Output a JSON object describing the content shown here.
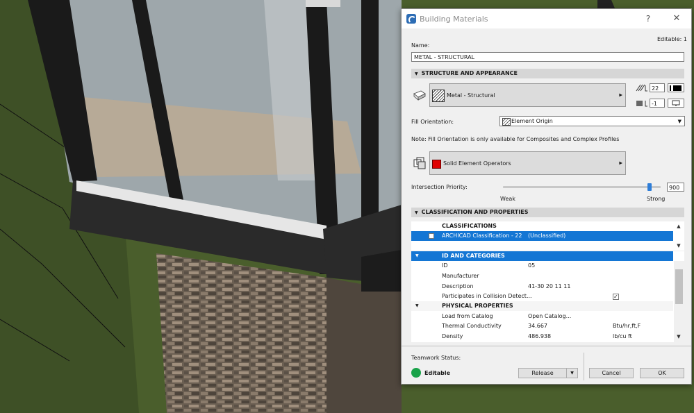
{
  "dialog": {
    "title": "Building Materials",
    "help": "?",
    "close": "✕",
    "editable": "Editable: 1",
    "name_label": "Name:",
    "name_value": "METAL - STRUCTURAL",
    "structure_section": "STRUCTURE AND APPEARANCE",
    "fill_name": "Metal - Structural",
    "pen_value": "22",
    "priority_field": "-1",
    "fill_orientation_label": "Fill Orientation:",
    "fill_orientation_value": "Element Origin",
    "note": "Note: Fill Orientation is only available for Composites and Complex Profiles",
    "solid_ops": "Solid Element Operators",
    "intersection_label": "Intersection Priority:",
    "intersection_value": "900",
    "intersection_fraction": 0.93,
    "weak": "Weak",
    "strong": "Strong",
    "classification_section": "CLASSIFICATION AND PROPERTIES",
    "classifications_header": "CLASSIFICATIONS",
    "classification_row": {
      "name": "ARCHICAD Classification - 22",
      "value": "(Unclassified)"
    },
    "id_categories": "ID AND CATEGORIES",
    "props": [
      {
        "name": "ID",
        "value": "05",
        "unit": ""
      },
      {
        "name": "Manufacturer",
        "value": "",
        "unit": ""
      },
      {
        "name": "Description",
        "value": "41-30 20 11 11",
        "unit": ""
      },
      {
        "name": "Participates in Collision Detect...",
        "value": "",
        "unit": "✓"
      }
    ],
    "physical": "PHYSICAL PROPERTIES",
    "phys_props": [
      {
        "name": "Load from Catalog",
        "value": "Open Catalog...",
        "unit": ""
      },
      {
        "name": "Thermal Conductivity",
        "value": "34.667",
        "unit": "Btu/hr,ft,F"
      },
      {
        "name": "Density",
        "value": "486.938",
        "unit": "lb/cu ft"
      }
    ],
    "teamwork_label": "Teamwork Status:",
    "teamwork_status": "Editable",
    "release": "Release",
    "cancel": "Cancel",
    "ok": "OK"
  },
  "colors": {
    "accent": "#1476d4",
    "status_green": "#1aa34a",
    "solid_red": "#e00000"
  }
}
